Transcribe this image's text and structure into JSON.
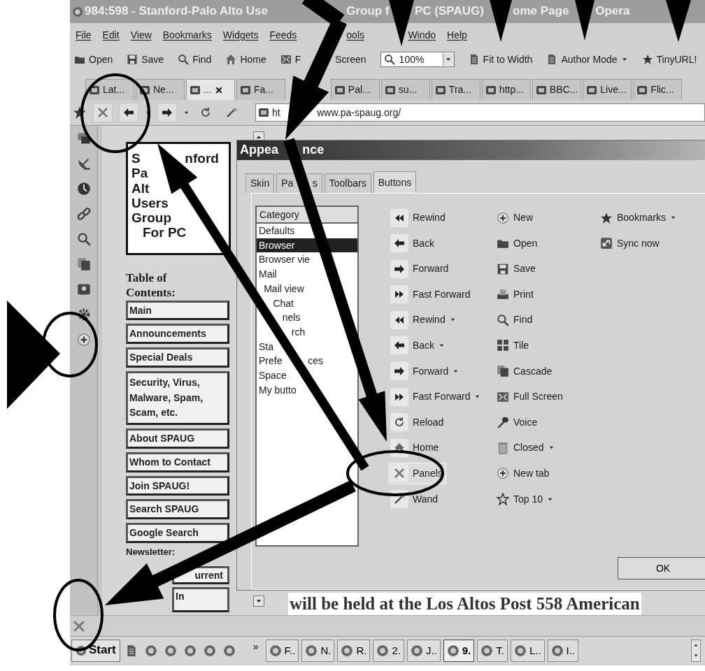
{
  "window": {
    "title": [
      "984:598 - Stanford-Palo Alto Use",
      "Group f",
      "PC (SPAUG)",
      "ome Page",
      "Opera"
    ]
  },
  "menu": [
    "File",
    "Edit",
    "View",
    "Bookmarks",
    "Widgets",
    "Feeds",
    "ools",
    "Windo",
    "Help"
  ],
  "toolbar": [
    {
      "kind": "button",
      "label": "Open"
    },
    {
      "kind": "button",
      "label": "Save"
    },
    {
      "kind": "button",
      "label": "Find"
    },
    {
      "kind": "button",
      "label": "Home"
    },
    {
      "kind": "button",
      "label": [
        "F",
        "Screen"
      ]
    },
    {
      "kind": "zoom",
      "value": "100%"
    },
    {
      "kind": "button",
      "label": "Fit to Width"
    },
    {
      "kind": "dropdown",
      "label": "Author Mode"
    },
    {
      "kind": "button",
      "label": "TinyURL!"
    }
  ],
  "tabs": [
    {
      "label": "Lat...",
      "selected": false
    },
    {
      "label": "Ne...",
      "selected": false
    },
    {
      "label": "...",
      "selected": true
    },
    {
      "label": "Fa...",
      "selected": false
    },
    {
      "label": "Pal...",
      "selected": false
    },
    {
      "label": "su...",
      "selected": false
    },
    {
      "label": "Tra...",
      "selected": false
    },
    {
      "label": "http...",
      "selected": false
    },
    {
      "label": "BBC...",
      "selected": false
    },
    {
      "label": "Live...",
      "selected": false
    },
    {
      "label": "Flic...",
      "selected": false
    }
  ],
  "address": {
    "url": [
      "ht",
      "www.pa-spaug.org/"
    ]
  },
  "page": {
    "logo_lines": [
      [
        "S",
        "nford"
      ],
      "Pa",
      "Alt",
      "Users",
      "Group",
      "For PC"
    ],
    "toc_heading": "Table of Contents:",
    "nav": [
      "Main",
      "Announcements",
      "Special Deals",
      "Security, Virus, Malware, Spam, Scam, etc.",
      "About SPAUG",
      "Whom to Contact",
      "Join SPAUG!",
      "Search SPAUG",
      "Google Search"
    ],
    "newsletter_label": "Newsletter:",
    "newsletter_links": [
      "urrent",
      "In"
    ],
    "body_text": "will be held at the Los Altos Post 558 American"
  },
  "dialog": {
    "title": [
      "Appea",
      "nce"
    ],
    "tabs": [
      {
        "label": "Skin",
        "selected": false
      },
      {
        "label": [
          "Pa",
          "s"
        ],
        "selected": false
      },
      {
        "label": "Toolbars",
        "selected": false
      },
      {
        "label": "Buttons",
        "selected": true
      }
    ],
    "category_header": "Category",
    "categories": [
      {
        "label": "Defaults",
        "selected": false
      },
      {
        "label": "Browser",
        "selected": true
      },
      {
        "label": "Browser vie",
        "selected": false
      },
      {
        "label": "Mail",
        "selected": false
      },
      {
        "label": "Mail view",
        "selected": false
      },
      {
        "label": "Chat",
        "selected": false
      },
      {
        "label": "nels",
        "selected": false
      },
      {
        "label": "rch",
        "selected": false
      },
      {
        "label": "Sta",
        "selected": false
      },
      {
        "label": [
          "Prefe",
          "ces"
        ],
        "selected": false
      },
      {
        "label": "Space",
        "selected": false
      },
      {
        "label": "My butto",
        "selected": false
      }
    ],
    "button_columns": [
      [
        {
          "label": "Rewind",
          "dropdown": false,
          "highlighted": false
        },
        {
          "label": "Back",
          "dropdown": false,
          "highlighted": false
        },
        {
          "label": "Forward",
          "dropdown": false,
          "highlighted": false
        },
        {
          "label": "Fast Forward",
          "dropdown": false,
          "highlighted": false
        },
        {
          "label": "Rewind",
          "dropdown": true,
          "highlighted": false
        },
        {
          "label": "Back",
          "dropdown": true,
          "highlighted": false
        },
        {
          "label": "Forward",
          "dropdown": true,
          "highlighted": false
        },
        {
          "label": "Fast Forward",
          "dropdown": true,
          "highlighted": false
        },
        {
          "label": "Reload",
          "dropdown": false,
          "highlighted": false
        },
        {
          "label": "Home",
          "dropdown": false,
          "highlighted": false
        },
        {
          "label": "Panels",
          "dropdown": false,
          "highlighted": true
        },
        {
          "label": "Wand",
          "dropdown": false,
          "highlighted": false
        }
      ],
      [
        {
          "label": "New",
          "dropdown": false,
          "highlighted": false
        },
        {
          "label": "Open",
          "dropdown": false,
          "highlighted": false
        },
        {
          "label": "Save",
          "dropdown": false,
          "highlighted": false
        },
        {
          "label": "Print",
          "dropdown": false,
          "highlighted": false
        },
        {
          "label": "Find",
          "dropdown": false,
          "highlighted": false
        },
        {
          "label": "Tile",
          "dropdown": false,
          "highlighted": false
        },
        {
          "label": "Cascade",
          "dropdown": false,
          "highlighted": false
        },
        {
          "label": "Full Screen",
          "dropdown": false,
          "highlighted": false
        },
        {
          "label": "Voice",
          "dropdown": false,
          "highlighted": false
        },
        {
          "label": "Closed",
          "dropdown": true,
          "highlighted": false
        },
        {
          "label": "New tab",
          "dropdown": false,
          "highlighted": false
        },
        {
          "label": "Top 10",
          "dropdown": true,
          "highlighted": false
        }
      ],
      [
        {
          "label": "Bookmarks",
          "dropdown": true,
          "highlighted": false
        },
        {
          "label": "Sync now",
          "dropdown": false,
          "highlighted": false
        }
      ]
    ],
    "ok": "OK"
  },
  "taskbar": {
    "start": "Start",
    "overflow": "»",
    "tasks": [
      {
        "label": "F..",
        "selected": false
      },
      {
        "label": "N.",
        "selected": false
      },
      {
        "label": "R.",
        "selected": false
      },
      {
        "label": "2.",
        "selected": false
      },
      {
        "label": "J..",
        "selected": false
      },
      {
        "label": "9.",
        "selected": true
      },
      {
        "label": "T.",
        "selected": false
      },
      {
        "label": "L..",
        "selected": false
      },
      {
        "label": "I..",
        "selected": false
      }
    ]
  }
}
